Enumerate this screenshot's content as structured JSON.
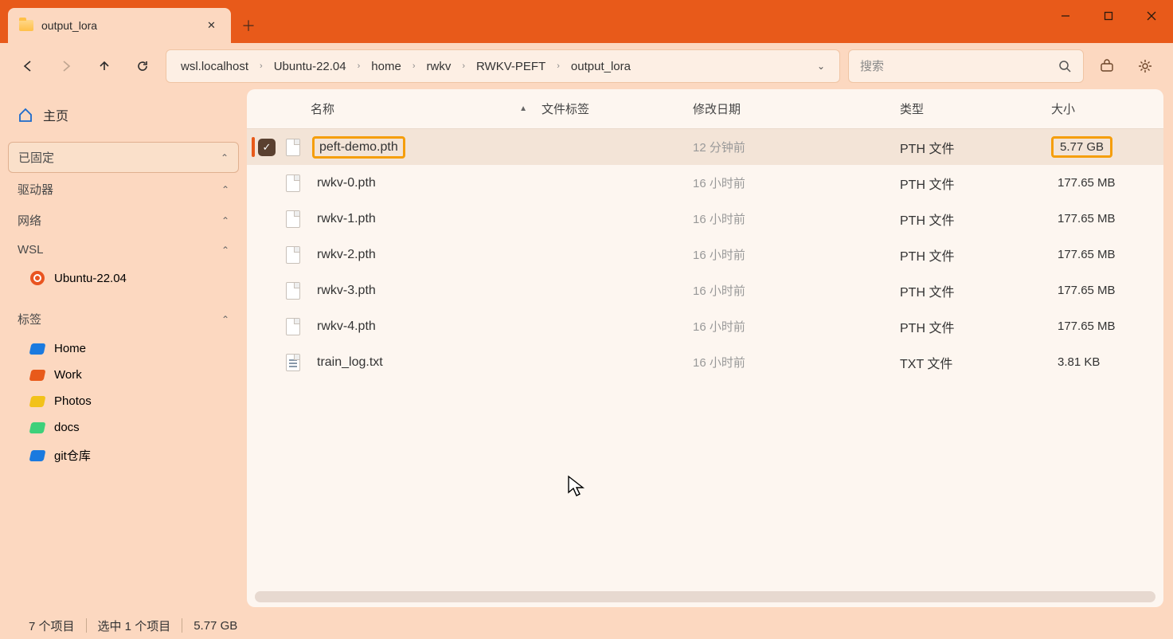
{
  "tab": {
    "title": "output_lora"
  },
  "breadcrumb": [
    "wsl.localhost",
    "Ubuntu-22.04",
    "home",
    "rwkv",
    "RWKV-PEFT",
    "output_lora"
  ],
  "search": {
    "placeholder": "搜索"
  },
  "sidebar": {
    "home": "主页",
    "pinned": "已固定",
    "drives": "驱动器",
    "network": "网络",
    "wsl": "WSL",
    "wsl_items": [
      "Ubuntu-22.04"
    ],
    "tags_label": "标签",
    "tags": [
      {
        "label": "Home",
        "color": "#1a7adf"
      },
      {
        "label": "Work",
        "color": "#e85a1a"
      },
      {
        "label": "Photos",
        "color": "#f2c21a"
      },
      {
        "label": "docs",
        "color": "#3dd07a"
      },
      {
        "label": "git仓库",
        "color": "#1a7adf"
      }
    ]
  },
  "columns": {
    "name": "名称",
    "tags": "文件标签",
    "date": "修改日期",
    "type": "类型",
    "size": "大小"
  },
  "files": [
    {
      "name": "peft-demo.pth",
      "date": "12 分钟前",
      "type": "PTH 文件",
      "size": "5.77 GB",
      "selected": true,
      "highlight": true,
      "icon": "file"
    },
    {
      "name": "rwkv-0.pth",
      "date": "16 小时前",
      "type": "PTH 文件",
      "size": "177.65 MB",
      "icon": "file"
    },
    {
      "name": "rwkv-1.pth",
      "date": "16 小时前",
      "type": "PTH 文件",
      "size": "177.65 MB",
      "icon": "file"
    },
    {
      "name": "rwkv-2.pth",
      "date": "16 小时前",
      "type": "PTH 文件",
      "size": "177.65 MB",
      "icon": "file"
    },
    {
      "name": "rwkv-3.pth",
      "date": "16 小时前",
      "type": "PTH 文件",
      "size": "177.65 MB",
      "icon": "file"
    },
    {
      "name": "rwkv-4.pth",
      "date": "16 小时前",
      "type": "PTH 文件",
      "size": "177.65 MB",
      "icon": "file"
    },
    {
      "name": "train_log.txt",
      "date": "16 小时前",
      "type": "TXT 文件",
      "size": "3.81 KB",
      "icon": "txt"
    }
  ],
  "status": {
    "items": "7 个项目",
    "selected": "选中 1 个项目",
    "size": "5.77 GB"
  }
}
